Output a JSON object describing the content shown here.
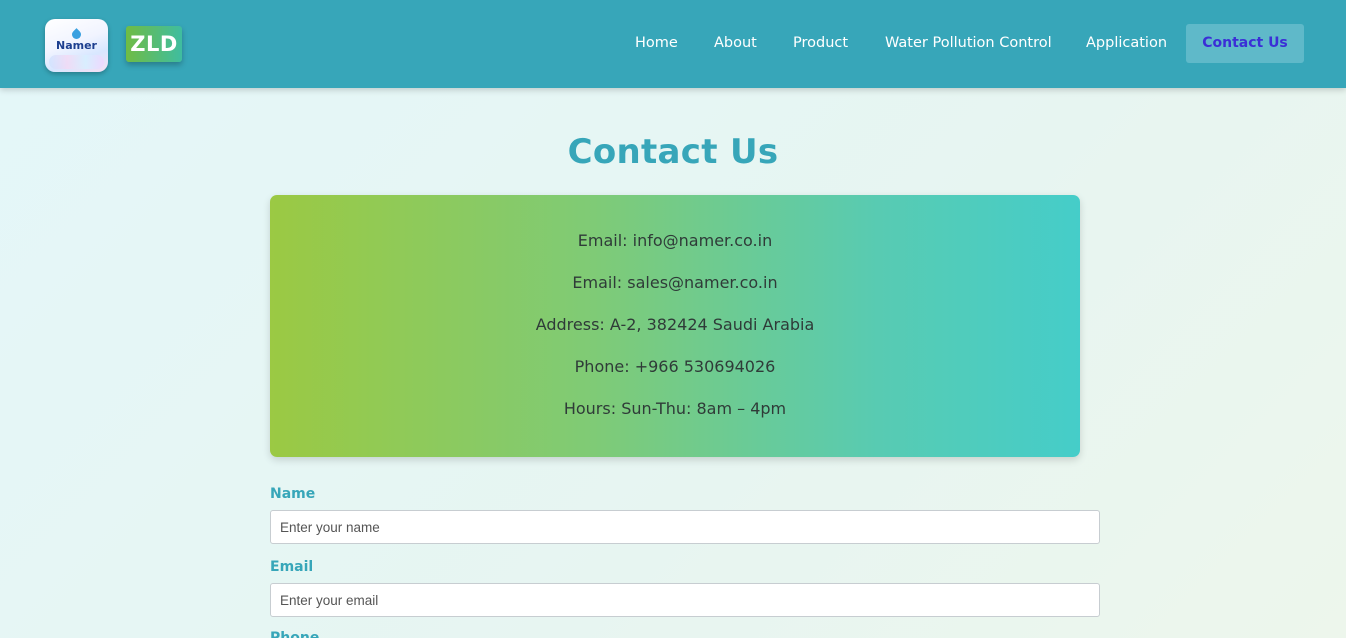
{
  "header": {
    "logo_text": "Namer",
    "zld_badge": "ZLD",
    "nav": {
      "home": "Home",
      "about": "About",
      "product": "Product",
      "water_pollution_control": "Water Pollution Control",
      "application": "Application",
      "contact_us": "Contact Us"
    }
  },
  "page": {
    "title": "Contact Us"
  },
  "info": {
    "email_primary": "Email: info@namer.co.in",
    "email_sales": "Email: sales@namer.co.in",
    "address": "Address: A-2, 382424 Saudi Arabia",
    "phone": "Phone: +966 530694026",
    "hours": "Hours: Sun-Thu: 8am – 4pm"
  },
  "form": {
    "name_label": "Name",
    "name_placeholder": "Enter your name",
    "email_label": "Email",
    "email_placeholder": "Enter your email",
    "phone_label": "Phone"
  },
  "colors": {
    "navbar": "#37a6b9",
    "accent": "#37a6b9",
    "active_nav_text": "#3b2fd6",
    "card_gradient_start": "#9bc943",
    "card_gradient_end": "#45cdc9"
  }
}
